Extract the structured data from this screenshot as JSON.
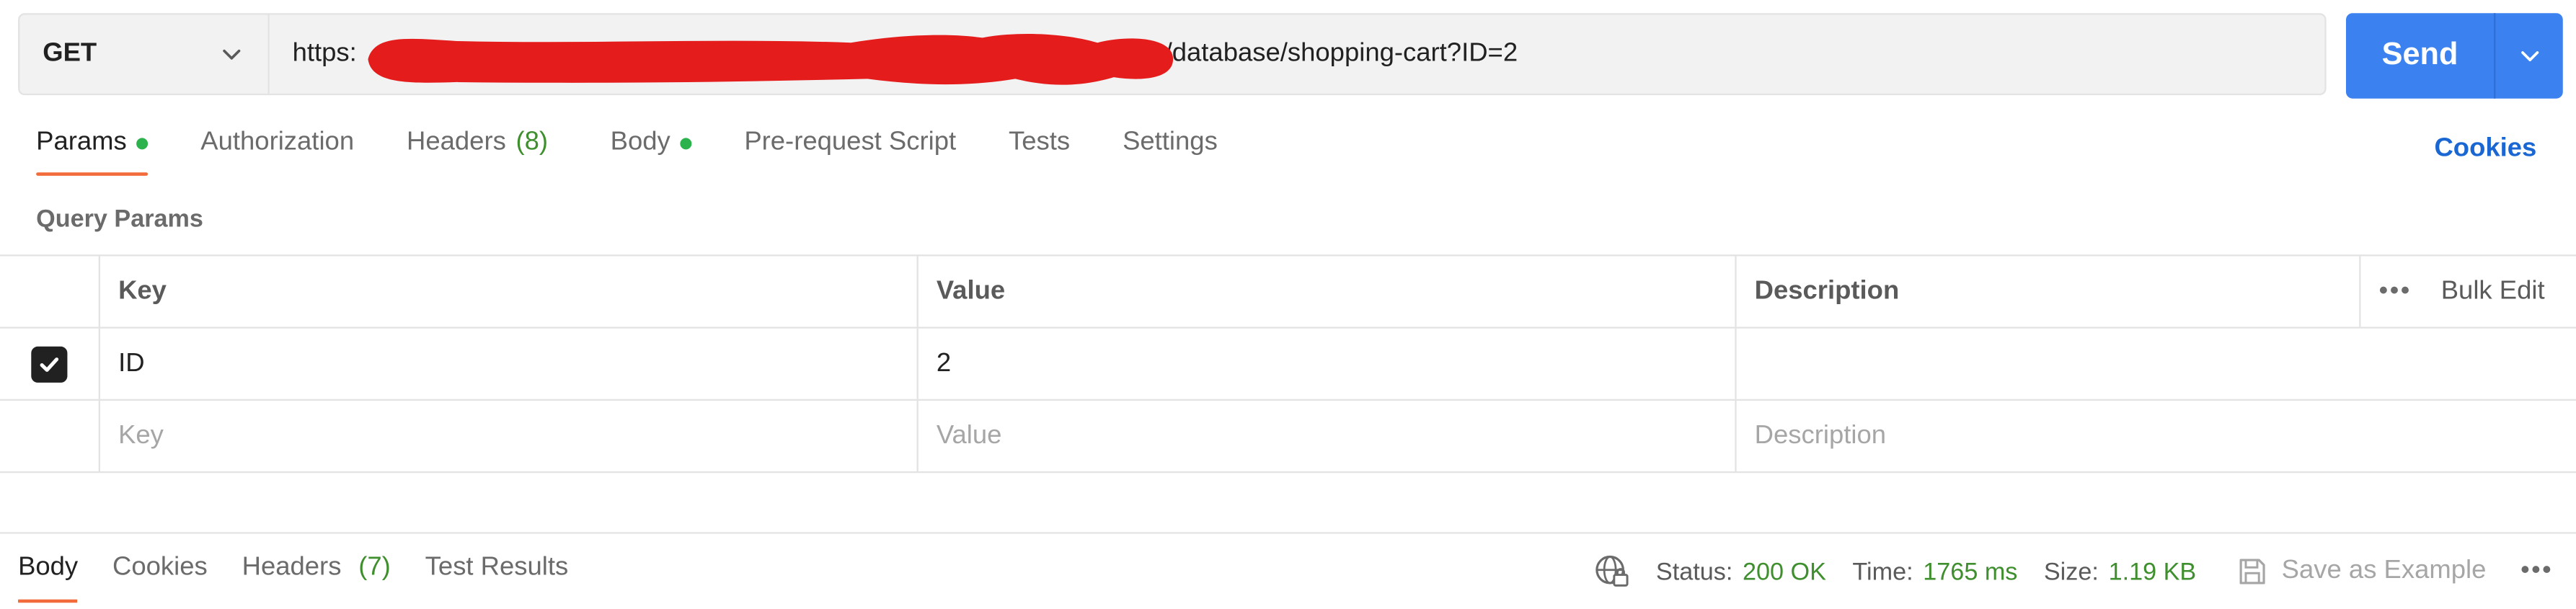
{
  "request": {
    "method": "GET",
    "url_prefix": "https:",
    "url_suffix": "/database/shopping-cart?ID=2",
    "send_label": "Send"
  },
  "req_tabs": [
    {
      "label": "Params",
      "dot": true
    },
    {
      "label": "Authorization"
    },
    {
      "label": "Headers",
      "count": "(8)"
    },
    {
      "label": "Body",
      "dot": true
    },
    {
      "label": "Pre-request Script"
    },
    {
      "label": "Tests"
    },
    {
      "label": "Settings"
    }
  ],
  "cookies_label": "Cookies",
  "query_params_label": "Query Params",
  "params_table": {
    "headers": {
      "key": "Key",
      "value": "Value",
      "description": "Description",
      "bulk_edit": "Bulk Edit"
    },
    "rows": [
      {
        "checked": true,
        "key": "ID",
        "value": "2",
        "description": ""
      }
    ],
    "placeholders": {
      "key": "Key",
      "value": "Value",
      "description": "Description"
    }
  },
  "response": {
    "tabs": [
      {
        "label": "Body"
      },
      {
        "label": "Cookies"
      },
      {
        "label": "Headers",
        "count": "(7)"
      },
      {
        "label": "Test Results"
      }
    ],
    "status_label": "Status:",
    "status_value": "200 OK",
    "time_label": "Time:",
    "time_value": "1765 ms",
    "size_label": "Size:",
    "size_value": "1.19 KB",
    "save_example_label": "Save as Example"
  },
  "icons": {
    "method_dropdown": "chevron-down-icon",
    "send_dropdown": "chevron-down-icon",
    "checkbox": "check-icon",
    "more": "more-horizontal-icon",
    "network": "globe-lock-icon",
    "save": "floppy-disk-icon"
  },
  "colors": {
    "send_button": "#3b82f0",
    "active_tab_underline": "#f26b3a",
    "status_ok": "#3f8f2f",
    "cookies_link": "#1a66d2",
    "redaction": "#e51c1c"
  }
}
